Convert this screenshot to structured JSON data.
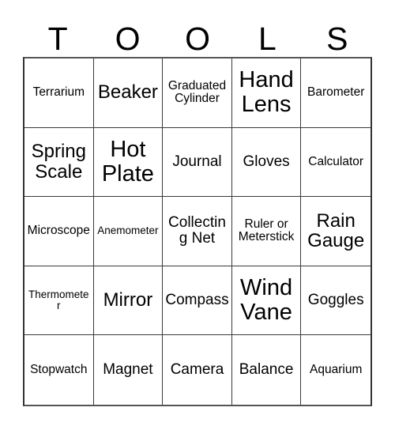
{
  "header": {
    "letters": [
      "T",
      "O",
      "O",
      "L",
      "S"
    ]
  },
  "grid": {
    "columns": 5,
    "rows": 5,
    "cells": [
      {
        "label": "Terrarium",
        "size": "s"
      },
      {
        "label": "Beaker",
        "size": "l"
      },
      {
        "label": "Graduated Cylinder",
        "size": "s"
      },
      {
        "label": "Hand Lens",
        "size": "xl"
      },
      {
        "label": "Barometer",
        "size": "s"
      },
      {
        "label": "Spring Scale",
        "size": "l"
      },
      {
        "label": "Hot Plate",
        "size": "xl"
      },
      {
        "label": "Journal",
        "size": "m"
      },
      {
        "label": "Gloves",
        "size": "m"
      },
      {
        "label": "Calculator",
        "size": "s"
      },
      {
        "label": "Microscope",
        "size": "s"
      },
      {
        "label": "Anemometer",
        "size": "xs"
      },
      {
        "label": "Collecting Net",
        "size": "m"
      },
      {
        "label": "Ruler or Meterstick",
        "size": "s"
      },
      {
        "label": "Rain Gauge",
        "size": "l"
      },
      {
        "label": "Thermometer",
        "size": "xs"
      },
      {
        "label": "Mirror",
        "size": "l"
      },
      {
        "label": "Compass",
        "size": "m"
      },
      {
        "label": "Wind Vane",
        "size": "xl"
      },
      {
        "label": "Goggles",
        "size": "m"
      },
      {
        "label": "Stopwatch",
        "size": "s"
      },
      {
        "label": "Magnet",
        "size": "m"
      },
      {
        "label": "Camera",
        "size": "m"
      },
      {
        "label": "Balance",
        "size": "m"
      },
      {
        "label": "Aquarium",
        "size": "s"
      }
    ]
  },
  "colors": {
    "background": "#ffffff",
    "text": "#000000",
    "grid_line": "#3a3a3a",
    "grid_border": "#555555"
  }
}
